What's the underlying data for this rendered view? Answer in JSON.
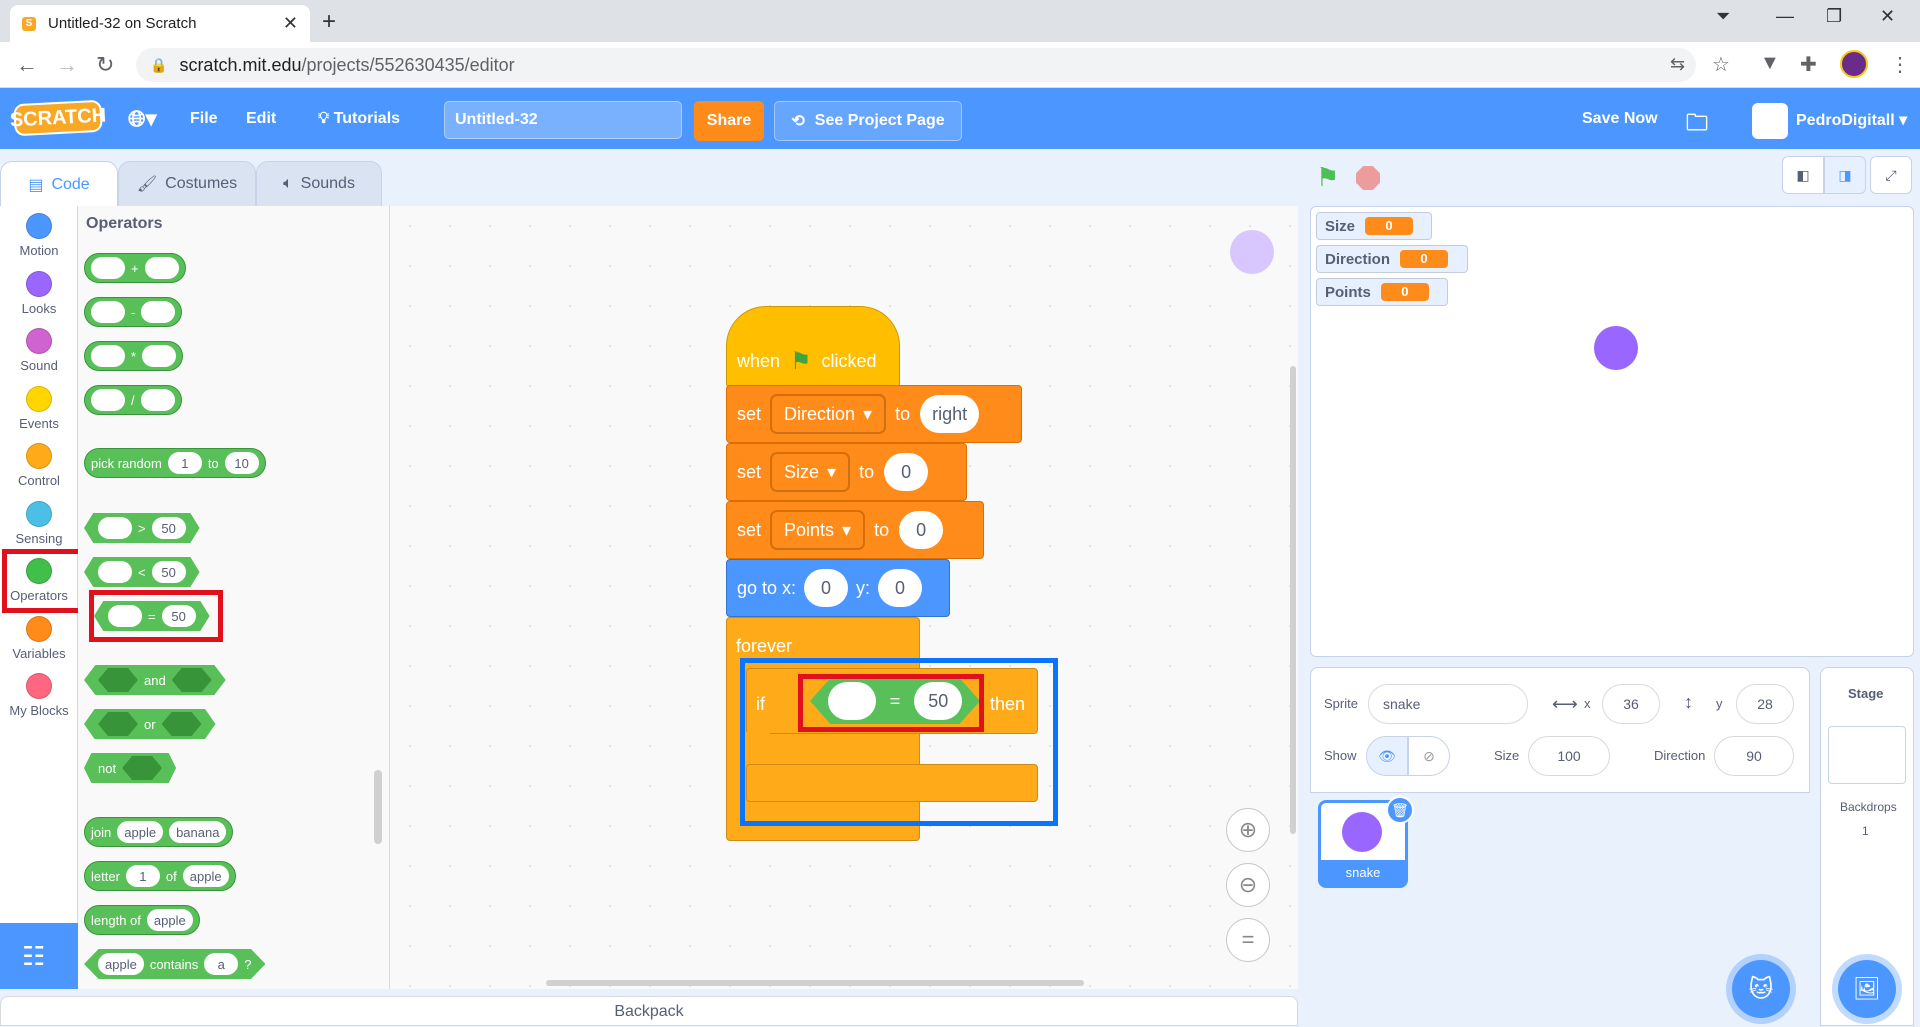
{
  "browser": {
    "tab_title": "Untitled-32 on Scratch",
    "url_host": "scratch.mit.edu",
    "url_path": "/projects/552630435/editor"
  },
  "menubar": {
    "logo": "SCRATCH",
    "file": "File",
    "edit": "Edit",
    "tutorials": "Tutorials",
    "project_title": "Untitled-32",
    "share": "Share",
    "see_project_page": "See Project Page",
    "save_now": "Save Now",
    "username": "PedroDigitall"
  },
  "editor_tabs": {
    "code": "Code",
    "costumes": "Costumes",
    "sounds": "Sounds"
  },
  "categories": [
    {
      "label": "Motion",
      "color": "#4c97ff"
    },
    {
      "label": "Looks",
      "color": "#9966ff"
    },
    {
      "label": "Sound",
      "color": "#cf63cf"
    },
    {
      "label": "Events",
      "color": "#ffd500"
    },
    {
      "label": "Control",
      "color": "#ffab19"
    },
    {
      "label": "Sensing",
      "color": "#4cbfe6"
    },
    {
      "label": "Operators",
      "color": "#40bf4a"
    },
    {
      "label": "Variables",
      "color": "#ff8c1a"
    },
    {
      "label": "My Blocks",
      "color": "#ff6680"
    }
  ],
  "palette": {
    "heading": "Operators",
    "add": "+",
    "subtract": "-",
    "multiply": "*",
    "divide": "/",
    "pick_random": "pick random",
    "rand_from": "1",
    "rand_to_label": "to",
    "rand_to": "10",
    "gt": ">",
    "lt": "<",
    "eq": "=",
    "cmp_value": "50",
    "and": "and",
    "or": "or",
    "not": "not",
    "join": "join",
    "join_a": "apple",
    "join_b": "banana",
    "letter": "letter",
    "letter_n": "1",
    "letter_of": "of",
    "letter_word": "apple",
    "length_of": "length of",
    "length_word": "apple",
    "contains_word": "apple",
    "contains": "contains",
    "contains_char": "a",
    "contains_q": "?"
  },
  "script": {
    "when": "when",
    "clicked": "clicked",
    "set": "set",
    "to": "to",
    "var1": "Direction",
    "val1": "right",
    "var2": "Size",
    "val2": "0",
    "var3": "Points",
    "val3": "0",
    "goto_x": "go to x:",
    "x": "0",
    "goto_y": "y:",
    "y": "0",
    "forever": "forever",
    "if": "if",
    "eq": "=",
    "eq_value": "50",
    "then": "then"
  },
  "stage_monitors": [
    {
      "name": "Size",
      "value": "0"
    },
    {
      "name": "Direction",
      "value": "0"
    },
    {
      "name": "Points",
      "value": "0"
    }
  ],
  "sprite_info": {
    "sprite_label": "Sprite",
    "sprite_name": "snake",
    "x_label": "x",
    "x": "36",
    "y_label": "y",
    "y": "28",
    "show_label": "Show",
    "size_label": "Size",
    "size": "100",
    "direction_label": "Direction",
    "direction": "90",
    "thumb_name": "snake"
  },
  "stage_panel": {
    "title": "Stage",
    "backdrops_label": "Backdrops",
    "backdrops_count": "1"
  },
  "backpack": "Backpack",
  "colors": {
    "menubar": "#4c97ff",
    "operators": "#59c059",
    "highlight_red": "#e0101d",
    "highlight_blue": "#0b74ff",
    "sprite": "#9966ff"
  }
}
